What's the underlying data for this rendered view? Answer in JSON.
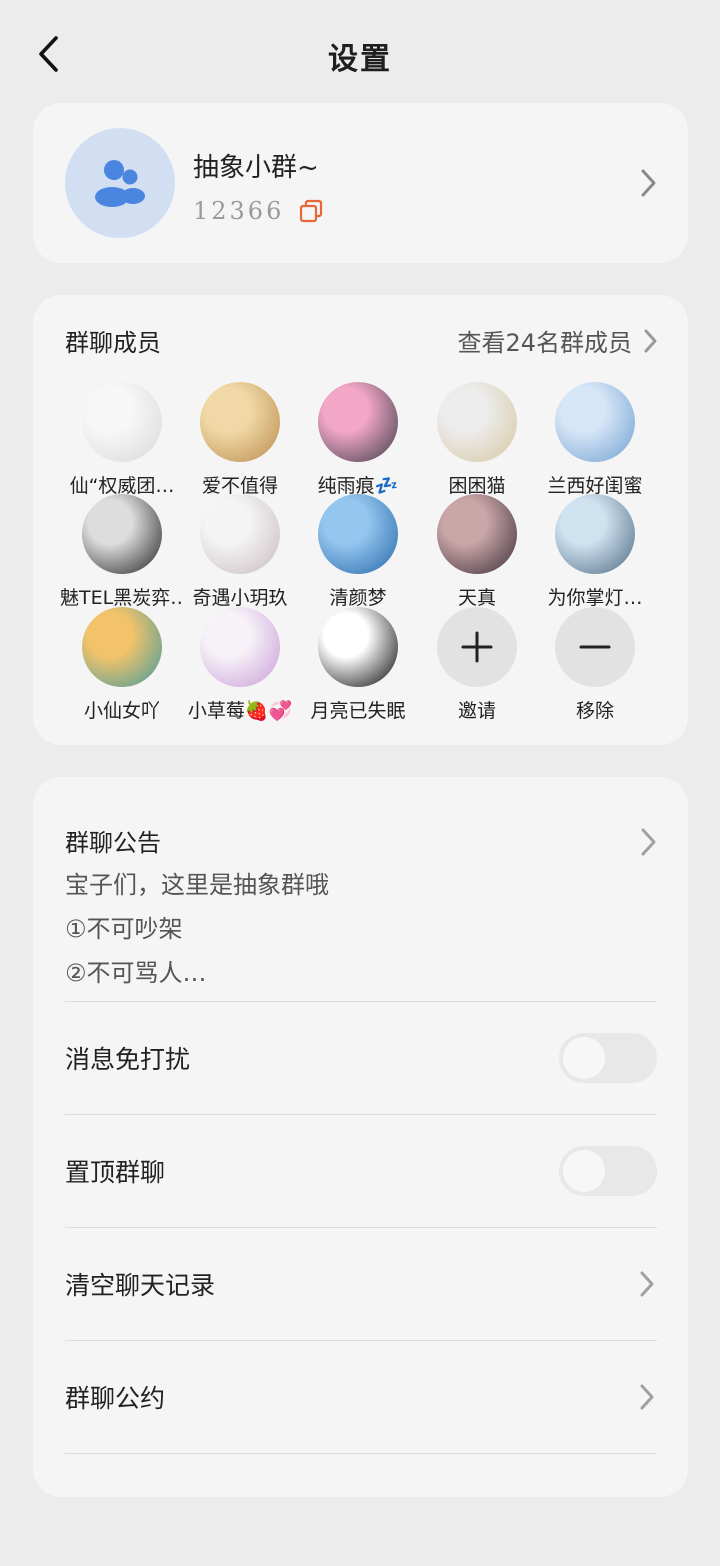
{
  "header": {
    "title": "设置"
  },
  "group": {
    "name": "抽象小群~",
    "id": "12366"
  },
  "members_section": {
    "title": "群聊成员",
    "view_all": "查看24名群成员",
    "members": [
      {
        "name": "仙“权威团…",
        "c1": "#f7f7f7",
        "c2": "#d8d8d8"
      },
      {
        "name": "爱不值得",
        "c1": "#f1d9a7",
        "c2": "#b88b4c"
      },
      {
        "name": "纯雨痕💤",
        "c1": "#f2a7c6",
        "c2": "#3a3a46"
      },
      {
        "name": "困困猫",
        "c1": "#ececec",
        "c2": "#d7c6a0"
      },
      {
        "name": "兰西好闺蜜",
        "c1": "#d7e6f7",
        "c2": "#6f9fd0"
      },
      {
        "name": "魅TEL黑炭弈…",
        "c1": "#dddddd",
        "c2": "#1f1f1f"
      },
      {
        "name": "奇遇小玥玖",
        "c1": "#f4f4f4",
        "c2": "#c7b9c0"
      },
      {
        "name": "清颜梦",
        "c1": "#94c6ef",
        "c2": "#2566a8"
      },
      {
        "name": "天真",
        "c1": "#c9a6a8",
        "c2": "#3a2c35"
      },
      {
        "name": "为你掌灯…",
        "c1": "#cfe2f0",
        "c2": "#4d6880"
      },
      {
        "name": "小仙女吖",
        "c1": "#f3c36a",
        "c2": "#3f9a9e"
      },
      {
        "name": "小草莓🍓💞",
        "c1": "#f6f2f8",
        "c2": "#c89ad6"
      },
      {
        "name": "月亮已失眠",
        "c1": "#ffffff",
        "c2": "#000000"
      }
    ],
    "invite_label": "邀请",
    "remove_label": "移除"
  },
  "notice": {
    "title": "群聊公告",
    "lines": [
      "宝子们，这里是抽象群哦",
      "①不可吵架",
      "②不可骂人…"
    ]
  },
  "settings": {
    "mute_label": "消息免打扰",
    "mute_on": false,
    "pin_label": "置顶群聊",
    "pin_on": false,
    "clear_label": "清空聊天记录",
    "rules_label": "群聊公约"
  },
  "colors": {
    "accent": "#e8673a",
    "avatar_blue": "#4a86df"
  }
}
